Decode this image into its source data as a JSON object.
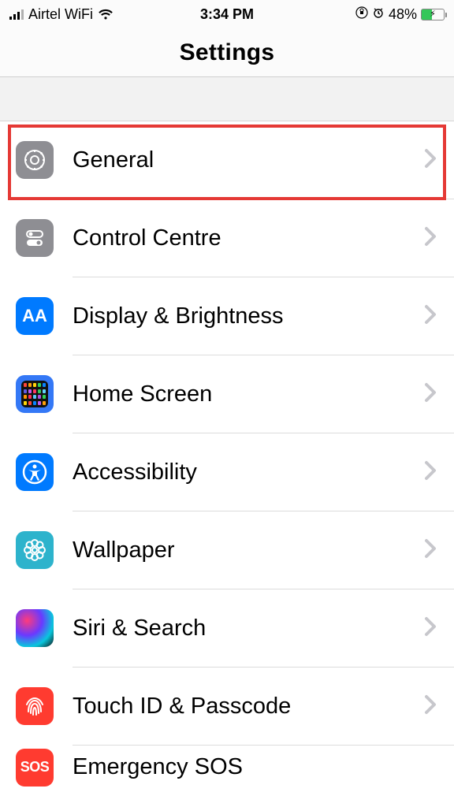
{
  "statusbar": {
    "carrier": "Airtel WiFi",
    "time": "3:34 PM",
    "battery_pct": "48%"
  },
  "navbar": {
    "title": "Settings"
  },
  "rows": [
    {
      "id": "general",
      "label": "General"
    },
    {
      "id": "control-centre",
      "label": "Control Centre"
    },
    {
      "id": "display",
      "label": "Display & Brightness"
    },
    {
      "id": "home-screen",
      "label": "Home Screen"
    },
    {
      "id": "accessibility",
      "label": "Accessibility"
    },
    {
      "id": "wallpaper",
      "label": "Wallpaper"
    },
    {
      "id": "siri",
      "label": "Siri & Search"
    },
    {
      "id": "touchid",
      "label": "Touch ID & Passcode"
    },
    {
      "id": "sos",
      "label": "Emergency SOS"
    }
  ],
  "sos_text": "SOS",
  "aa_text": "AA"
}
